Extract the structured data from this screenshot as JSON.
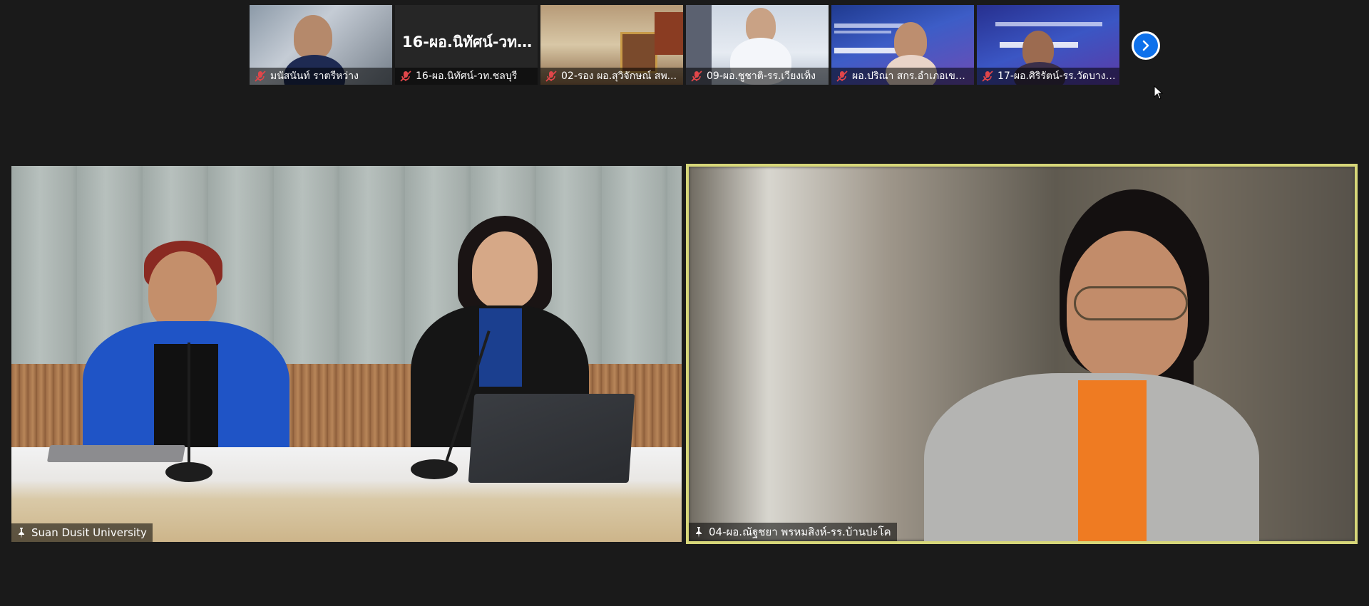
{
  "thumbnails": [
    {
      "name": "มนัสนันท์ ราตรีหว่าง",
      "muted": true
    },
    {
      "name": "16-ผอ.นิทัศน์-วท.ชลบุรี",
      "display_name": "16-ผอ.นิทัศน์-วท...",
      "muted": true
    },
    {
      "name": "02-รอง ผอ.สุวิจักษณ์ สพ...",
      "muted": true
    },
    {
      "name": "09-ผอ.ชูชาติ-รร.เวียงเท็ง",
      "muted": true
    },
    {
      "name": "ผอ.ปริณา สกร.อำเภอเขมร...",
      "muted": true
    },
    {
      "name": "17-ผอ.ศิริรัตน์-รร.วัดบางปิ...",
      "muted": true
    }
  ],
  "main_tiles": [
    {
      "name": "Suan Dusit University",
      "pinned": true
    },
    {
      "name": "04-ผอ.ณัฐชยา พรหมสิงห์-รร.บ้านปะโค",
      "pinned": true,
      "active_speaker": true
    }
  ],
  "colors": {
    "background": "#1a1a1a",
    "active_speaker_border": "#d6d679",
    "next_button": "#0e71eb",
    "mute_icon": "#e0464a"
  },
  "icons": {
    "mute": "microphone-muted-icon",
    "pin": "pin-icon",
    "next": "chevron-right-icon",
    "cursor": "mouse-cursor-icon"
  }
}
